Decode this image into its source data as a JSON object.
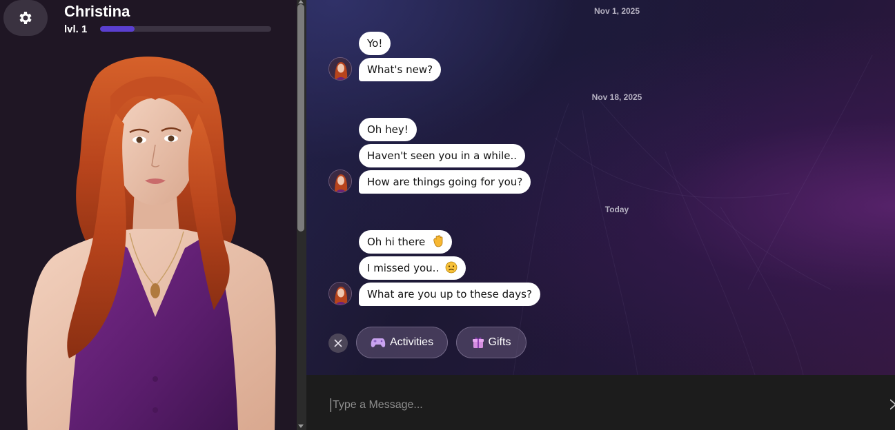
{
  "character": {
    "name": "Christina",
    "level_label": "lvl. 1",
    "xp_progress_percent": 20
  },
  "icons": {
    "settings": "gear-icon",
    "close": "close-icon",
    "activities": "gamepad-icon",
    "gifts": "gift-icon",
    "send": "send-icon"
  },
  "chat": {
    "groups": [
      {
        "date": "Nov 1, 2025",
        "messages": [
          {
            "text": "Yo!"
          },
          {
            "text": "What's new?"
          }
        ]
      },
      {
        "date": "Nov 18, 2025",
        "messages": [
          {
            "text": "Oh hey!"
          },
          {
            "text": "Haven't seen you in a while.."
          },
          {
            "text": "How are things going for you?"
          }
        ]
      },
      {
        "date": "Today",
        "messages": [
          {
            "text": "Oh hi there",
            "emoji": "waving-hand"
          },
          {
            "text": "I missed you..",
            "emoji": "sad-face"
          },
          {
            "text": "What are you up to these days?"
          }
        ]
      }
    ]
  },
  "actions": {
    "activities_label": "Activities",
    "gifts_label": "Gifts"
  },
  "input": {
    "placeholder": "Type a Message...",
    "value": ""
  },
  "colors": {
    "xp_fill": "#5a3fd0",
    "left_panel": "#1f1624",
    "input_bar": "#1c1c1c",
    "bubble": "#ffffff"
  }
}
